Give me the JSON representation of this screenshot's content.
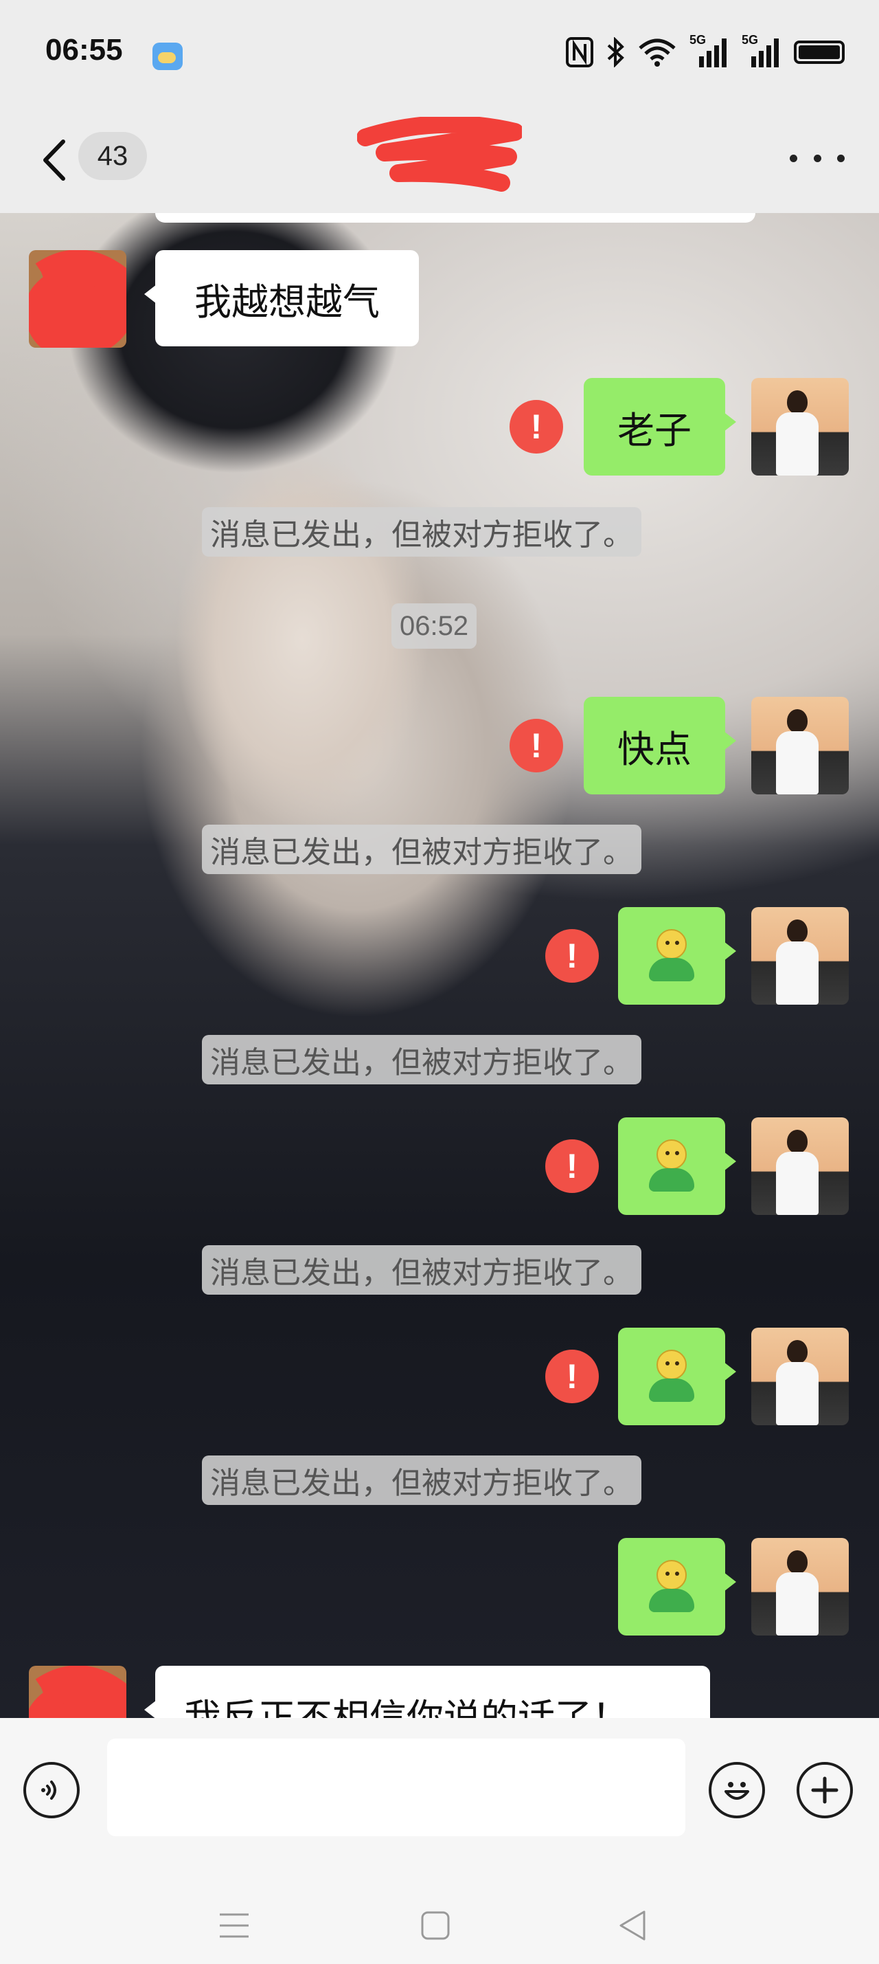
{
  "status_bar": {
    "time": "06:55",
    "weather_icon": "partly-cloudy-icon",
    "icons": [
      "nfc-icon",
      "bluetooth-icon",
      "wifi-icon",
      "5g-signal-icon",
      "5g-signal-icon",
      "battery-icon"
    ],
    "network_labels": [
      "5G",
      "5G"
    ]
  },
  "header": {
    "back_icon": "chevron-left-icon",
    "unread_count": "43",
    "more_icon": "ellipsis-icon"
  },
  "messages": [
    {
      "type": "recv",
      "text": "我越想越气"
    },
    {
      "type": "sent",
      "text": "老子",
      "failed": true
    },
    {
      "type": "system",
      "text": "消息已发出，但被对方拒收了。"
    },
    {
      "type": "timestamp",
      "text": "06:52"
    },
    {
      "type": "sent",
      "text": "快点",
      "failed": true
    },
    {
      "type": "system",
      "text": "消息已发出，但被对方拒收了。"
    },
    {
      "type": "sent",
      "sticker": "green-person-emoji",
      "failed": true
    },
    {
      "type": "system",
      "text": "消息已发出，但被对方拒收了。"
    },
    {
      "type": "sent",
      "sticker": "green-person-emoji",
      "failed": true
    },
    {
      "type": "system",
      "text": "消息已发出，但被对方拒收了。"
    },
    {
      "type": "sent",
      "sticker": "green-person-emoji",
      "failed": true
    },
    {
      "type": "system",
      "text": "消息已发出，但被对方拒收了。"
    },
    {
      "type": "sent",
      "sticker": "green-person-emoji",
      "failed": false
    },
    {
      "type": "recv",
      "text": "我反正不相信你说的话了！"
    }
  ],
  "failed_icon_glyph": "!",
  "input_bar": {
    "voice_icon": "voice-icon",
    "mic_icon": "microphone-icon",
    "emoji_icon": "smiley-icon",
    "plus_icon": "plus-icon",
    "text_value": ""
  },
  "nav_bar": {
    "icons": [
      "menu-icon",
      "home-square-icon",
      "back-triangle-icon"
    ]
  },
  "colors": {
    "sent_bubble": "#95ec69",
    "recv_bubble": "#ffffff",
    "error_badge": "#f15047",
    "redaction": "#f2403a"
  }
}
